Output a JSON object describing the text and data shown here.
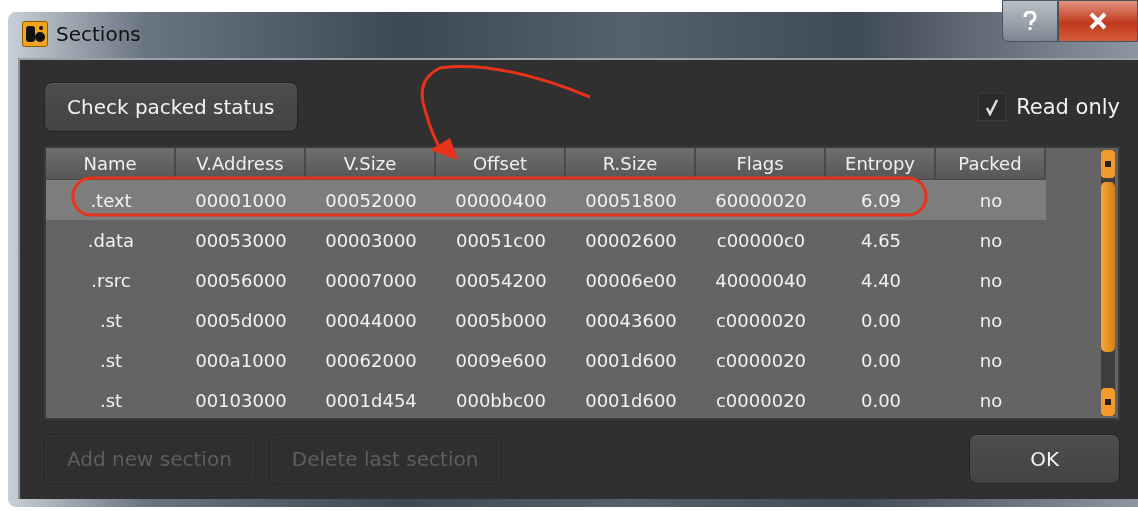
{
  "window": {
    "title": "Sections"
  },
  "check_button": {
    "label": "Check packed status"
  },
  "read_only": {
    "label": "Read only",
    "checked": true
  },
  "table": {
    "columns": [
      "Name",
      "V.Address",
      "V.Size",
      "Offset",
      "R.Size",
      "Flags",
      "Entropy",
      "Packed"
    ],
    "rows": [
      {
        "cells": [
          ".text",
          "00001000",
          "00052000",
          "00000400",
          "00051800",
          "60000020",
          "6.09",
          "no"
        ],
        "selected": true
      },
      {
        "cells": [
          ".data",
          "00053000",
          "00003000",
          "00051c00",
          "00002600",
          "c00000c0",
          "4.65",
          "no"
        ],
        "selected": false
      },
      {
        "cells": [
          ".rsrc",
          "00056000",
          "00007000",
          "00054200",
          "00006e00",
          "40000040",
          "4.40",
          "no"
        ],
        "selected": false
      },
      {
        "cells": [
          ".st",
          "0005d000",
          "00044000",
          "0005b000",
          "00043600",
          "c0000020",
          "0.00",
          "no"
        ],
        "selected": false
      },
      {
        "cells": [
          ".st",
          "000a1000",
          "00062000",
          "0009e600",
          "0001d600",
          "c0000020",
          "0.00",
          "no"
        ],
        "selected": false
      },
      {
        "cells": [
          ".st",
          "00103000",
          "0001d454",
          "000bbc00",
          "0001d600",
          "c0000020",
          "0.00",
          "no"
        ],
        "selected": false
      }
    ]
  },
  "buttons": [
    {
      "label": "Add new section",
      "disabled": true
    },
    {
      "label": "Delete last section",
      "disabled": true
    },
    {
      "label": "OK",
      "disabled": false
    }
  ]
}
